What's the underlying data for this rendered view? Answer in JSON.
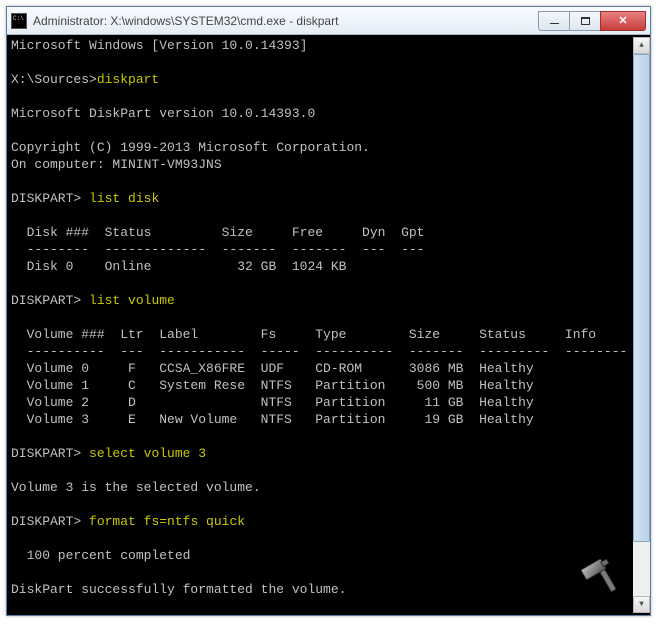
{
  "window": {
    "title": "Administrator: X:\\windows\\SYSTEM32\\cmd.exe - diskpart"
  },
  "header": {
    "version_line": "Microsoft Windows [Version 10.0.14393]",
    "prompt_path": "X:\\Sources>",
    "cmd1": "diskpart",
    "dp_version": "Microsoft DiskPart version 10.0.14393.0",
    "copyright": "Copyright (C) 1999-2013 Microsoft Corporation.",
    "on_computer": "On computer: MININT-VM93JNS"
  },
  "dp_prompt": "DISKPART>",
  "cmd_list_disk": "list disk",
  "disk_header": "  Disk ###  Status         Size     Free     Dyn  Gpt",
  "disk_sep": "  --------  -------------  -------  -------  ---  ---",
  "disk_row0": "  Disk 0    Online           32 GB  1024 KB",
  "cmd_list_volume": "list volume",
  "vol_header": "  Volume ###  Ltr  Label        Fs     Type        Size     Status     Info",
  "vol_sep": "  ----------  ---  -----------  -----  ----------  -------  ---------  --------",
  "vol_row0": "  Volume 0     F   CCSA_X86FRE  UDF    CD-ROM      3086 MB  Healthy",
  "vol_row1": "  Volume 1     C   System Rese  NTFS   Partition    500 MB  Healthy",
  "vol_row2": "  Volume 2     D                NTFS   Partition     11 GB  Healthy",
  "vol_row3": "  Volume 3     E   New Volume   NTFS   Partition     19 GB  Healthy",
  "cmd_select": "select volume 3",
  "select_result": "Volume 3 is the selected volume.",
  "cmd_format": "format fs=ntfs quick",
  "format_progress": "  100 percent completed",
  "format_result": "DiskPart successfully formatted the volume.",
  "disks": [
    {
      "id": "Disk 0",
      "status": "Online",
      "size": "32 GB",
      "free": "1024 KB",
      "dyn": "",
      "gpt": ""
    }
  ],
  "volumes": [
    {
      "id": "Volume 0",
      "ltr": "F",
      "label": "CCSA_X86FRE",
      "fs": "UDF",
      "type": "CD-ROM",
      "size": "3086 MB",
      "status": "Healthy",
      "info": ""
    },
    {
      "id": "Volume 1",
      "ltr": "C",
      "label": "System Rese",
      "fs": "NTFS",
      "type": "Partition",
      "size": "500 MB",
      "status": "Healthy",
      "info": ""
    },
    {
      "id": "Volume 2",
      "ltr": "D",
      "label": "",
      "fs": "NTFS",
      "type": "Partition",
      "size": "11 GB",
      "status": "Healthy",
      "info": ""
    },
    {
      "id": "Volume 3",
      "ltr": "E",
      "label": "New Volume",
      "fs": "NTFS",
      "type": "Partition",
      "size": "19 GB",
      "status": "Healthy",
      "info": ""
    }
  ]
}
